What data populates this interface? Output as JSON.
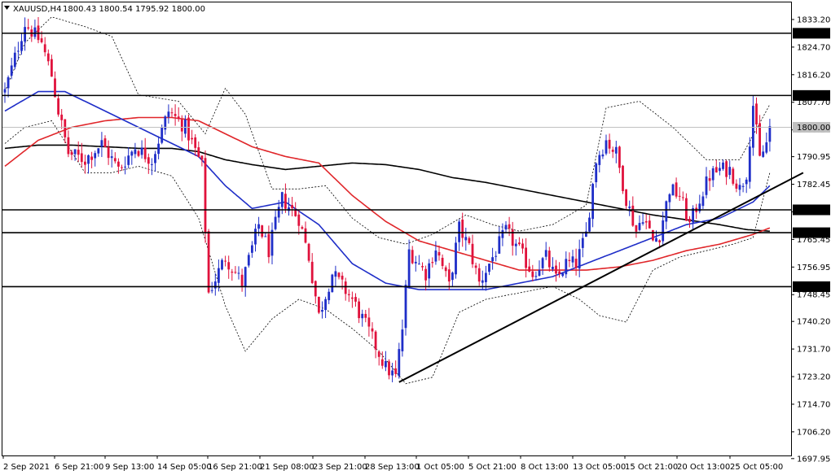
{
  "header": {
    "symbol": "XAUUSD,H4",
    "ohlc": "1800.43 1800.54 1795.92 1800.00"
  },
  "colors": {
    "background": "#ffffff",
    "bull_candle": "#1f2ec8",
    "bear_candle": "#e0123c",
    "ma_fast": "#1f2ec8",
    "ma_medium": "#e0262a",
    "ma_slow": "#000000",
    "bollinger": "#000000",
    "levels": "#000000",
    "price_line": "#c0c0c0"
  },
  "chart_data": {
    "type": "candlestick",
    "title": "XAUUSD,H4",
    "ylim": [
      1695.0,
      1838.0
    ],
    "y_ticks": [
      1833.2,
      1824.7,
      1816.2,
      1807.7,
      1799.2,
      1790.95,
      1782.45,
      1773.95,
      1765.45,
      1756.95,
      1748.45,
      1740.2,
      1731.7,
      1723.2,
      1714.7,
      1706.2,
      1697.95
    ],
    "x_ticks": [
      "2 Sep 2021",
      "6 Sep 21:00",
      "9 Sep 13:00",
      "14 Sep 05:00",
      "16 Sep 21:00",
      "21 Sep 08:00",
      "23 Sep 21:00",
      "28 Sep 13:00",
      "1 Oct 05:00",
      "5 Oct 21:00",
      "8 Oct 13:00",
      "13 Oct 05:00",
      "15 Oct 21:00",
      "20 Oct 13:00",
      "25 Oct 05:00"
    ],
    "horizontal_levels": [
      {
        "value": 1828.96,
        "label": "1828.96"
      },
      {
        "value": 1809.8,
        "label": "1809.80"
      },
      {
        "value": 1774.57,
        "label": "1774.57"
      },
      {
        "value": 1767.53,
        "label": "1767.53"
      },
      {
        "value": 1750.9,
        "label": "1750.90"
      }
    ],
    "current_price": {
      "value": 1800.0,
      "label": "1800.00"
    },
    "trendline": {
      "from_bar": 118,
      "from_value": 1721.5,
      "to_bar": 239,
      "to_value": 1786.0
    },
    "anchors": [
      [
        0,
        1811
      ],
      [
        6,
        1832
      ],
      [
        11,
        1826
      ],
      [
        14,
        1816
      ],
      [
        16,
        1805
      ],
      [
        19,
        1792
      ],
      [
        24,
        1790
      ],
      [
        29,
        1795
      ],
      [
        34,
        1787
      ],
      [
        39,
        1794
      ],
      [
        44,
        1790
      ],
      [
        49,
        1805
      ],
      [
        54,
        1800
      ],
      [
        59,
        1788
      ],
      [
        61,
        1749
      ],
      [
        66,
        1760
      ],
      [
        71,
        1752
      ],
      [
        76,
        1770
      ],
      [
        79,
        1762
      ],
      [
        83,
        1778
      ],
      [
        88,
        1772
      ],
      [
        91,
        1760
      ],
      [
        94,
        1742
      ],
      [
        98,
        1755
      ],
      [
        104,
        1747
      ],
      [
        109,
        1737
      ],
      [
        114,
        1726
      ],
      [
        117,
        1723
      ],
      [
        119,
        1738
      ],
      [
        121,
        1762
      ],
      [
        126,
        1755
      ],
      [
        129,
        1763
      ],
      [
        133,
        1751
      ],
      [
        136,
        1769
      ],
      [
        139,
        1763
      ],
      [
        142,
        1752
      ],
      [
        146,
        1760
      ],
      [
        150,
        1768
      ],
      [
        154,
        1762
      ],
      [
        158,
        1755
      ],
      [
        162,
        1760
      ],
      [
        165,
        1753
      ],
      [
        168,
        1758
      ],
      [
        171,
        1758
      ],
      [
        174,
        1767
      ],
      [
        177,
        1790
      ],
      [
        180,
        1796
      ],
      [
        183,
        1792
      ],
      [
        186,
        1778
      ],
      [
        189,
        1768
      ],
      [
        191,
        1773
      ],
      [
        194,
        1765
      ],
      [
        196,
        1767
      ],
      [
        199,
        1781
      ],
      [
        202,
        1779
      ],
      [
        205,
        1770
      ],
      [
        208,
        1778
      ],
      [
        211,
        1785
      ],
      [
        214,
        1787
      ],
      [
        217,
        1787
      ],
      [
        220,
        1781
      ],
      [
        222,
        1786
      ],
      [
        224,
        1807
      ],
      [
        226,
        1790
      ],
      [
        228,
        1795
      ],
      [
        229,
        1800
      ]
    ],
    "ma_fast": [
      [
        0,
        1805
      ],
      [
        10,
        1811
      ],
      [
        18,
        1811
      ],
      [
        28,
        1806
      ],
      [
        38,
        1801
      ],
      [
        48,
        1796
      ],
      [
        58,
        1791
      ],
      [
        66,
        1782
      ],
      [
        74,
        1775
      ],
      [
        84,
        1777
      ],
      [
        94,
        1770
      ],
      [
        104,
        1758
      ],
      [
        114,
        1752
      ],
      [
        124,
        1750
      ],
      [
        134,
        1750
      ],
      [
        144,
        1750
      ],
      [
        154,
        1752
      ],
      [
        164,
        1754
      ],
      [
        174,
        1758
      ],
      [
        184,
        1762
      ],
      [
        194,
        1766
      ],
      [
        204,
        1770
      ],
      [
        214,
        1772
      ],
      [
        224,
        1777
      ],
      [
        229,
        1782
      ]
    ],
    "ma_medium": [
      [
        0,
        1788
      ],
      [
        10,
        1796
      ],
      [
        20,
        1800
      ],
      [
        30,
        1802
      ],
      [
        40,
        1803
      ],
      [
        50,
        1803
      ],
      [
        58,
        1802
      ],
      [
        66,
        1798
      ],
      [
        74,
        1794
      ],
      [
        84,
        1791
      ],
      [
        94,
        1789
      ],
      [
        104,
        1779
      ],
      [
        114,
        1771
      ],
      [
        124,
        1765
      ],
      [
        134,
        1762
      ],
      [
        144,
        1759
      ],
      [
        154,
        1756
      ],
      [
        164,
        1756
      ],
      [
        174,
        1756
      ],
      [
        184,
        1757
      ],
      [
        194,
        1759
      ],
      [
        204,
        1762
      ],
      [
        214,
        1764
      ],
      [
        224,
        1767
      ],
      [
        229,
        1769
      ]
    ],
    "ma_slow": [
      [
        0,
        1793.5
      ],
      [
        10,
        1794.5
      ],
      [
        20,
        1794.5
      ],
      [
        30,
        1794
      ],
      [
        40,
        1793.5
      ],
      [
        50,
        1793.5
      ],
      [
        58,
        1792.5
      ],
      [
        66,
        1790
      ],
      [
        74,
        1788.5
      ],
      [
        84,
        1787
      ],
      [
        94,
        1788
      ],
      [
        104,
        1789
      ],
      [
        114,
        1788.5
      ],
      [
        124,
        1787
      ],
      [
        134,
        1784.5
      ],
      [
        144,
        1783
      ],
      [
        154,
        1781
      ],
      [
        164,
        1779
      ],
      [
        174,
        1777
      ],
      [
        184,
        1775
      ],
      [
        194,
        1773
      ],
      [
        204,
        1771.5
      ],
      [
        214,
        1770
      ],
      [
        222,
        1768.5
      ],
      [
        229,
        1768
      ]
    ],
    "bb_upper": [
      [
        0,
        1811
      ],
      [
        6,
        1826
      ],
      [
        14,
        1834
      ],
      [
        24,
        1831
      ],
      [
        32,
        1828
      ],
      [
        40,
        1810
      ],
      [
        52,
        1808
      ],
      [
        60,
        1798
      ],
      [
        66,
        1812
      ],
      [
        72,
        1804
      ],
      [
        80,
        1781
      ],
      [
        88,
        1781
      ],
      [
        96,
        1782
      ],
      [
        104,
        1772
      ],
      [
        112,
        1766
      ],
      [
        120,
        1764
      ],
      [
        128,
        1767
      ],
      [
        138,
        1773
      ],
      [
        146,
        1770
      ],
      [
        154,
        1768
      ],
      [
        164,
        1770
      ],
      [
        174,
        1776
      ],
      [
        180,
        1806
      ],
      [
        190,
        1808
      ],
      [
        200,
        1800
      ],
      [
        210,
        1790
      ],
      [
        220,
        1790
      ],
      [
        229,
        1807
      ]
    ],
    "bb_lower": [
      [
        0,
        1795
      ],
      [
        6,
        1800
      ],
      [
        14,
        1802
      ],
      [
        24,
        1786
      ],
      [
        32,
        1786
      ],
      [
        40,
        1788
      ],
      [
        50,
        1785
      ],
      [
        58,
        1772
      ],
      [
        66,
        1745
      ],
      [
        72,
        1731
      ],
      [
        80,
        1741
      ],
      [
        88,
        1747
      ],
      [
        96,
        1744
      ],
      [
        104,
        1738
      ],
      [
        112,
        1731
      ],
      [
        120,
        1721
      ],
      [
        128,
        1723
      ],
      [
        136,
        1743
      ],
      [
        144,
        1747
      ],
      [
        154,
        1749
      ],
      [
        164,
        1751
      ],
      [
        172,
        1747
      ],
      [
        178,
        1742
      ],
      [
        186,
        1740
      ],
      [
        194,
        1756
      ],
      [
        202,
        1760
      ],
      [
        210,
        1762
      ],
      [
        218,
        1764
      ],
      [
        224,
        1766
      ],
      [
        229,
        1786
      ]
    ]
  }
}
